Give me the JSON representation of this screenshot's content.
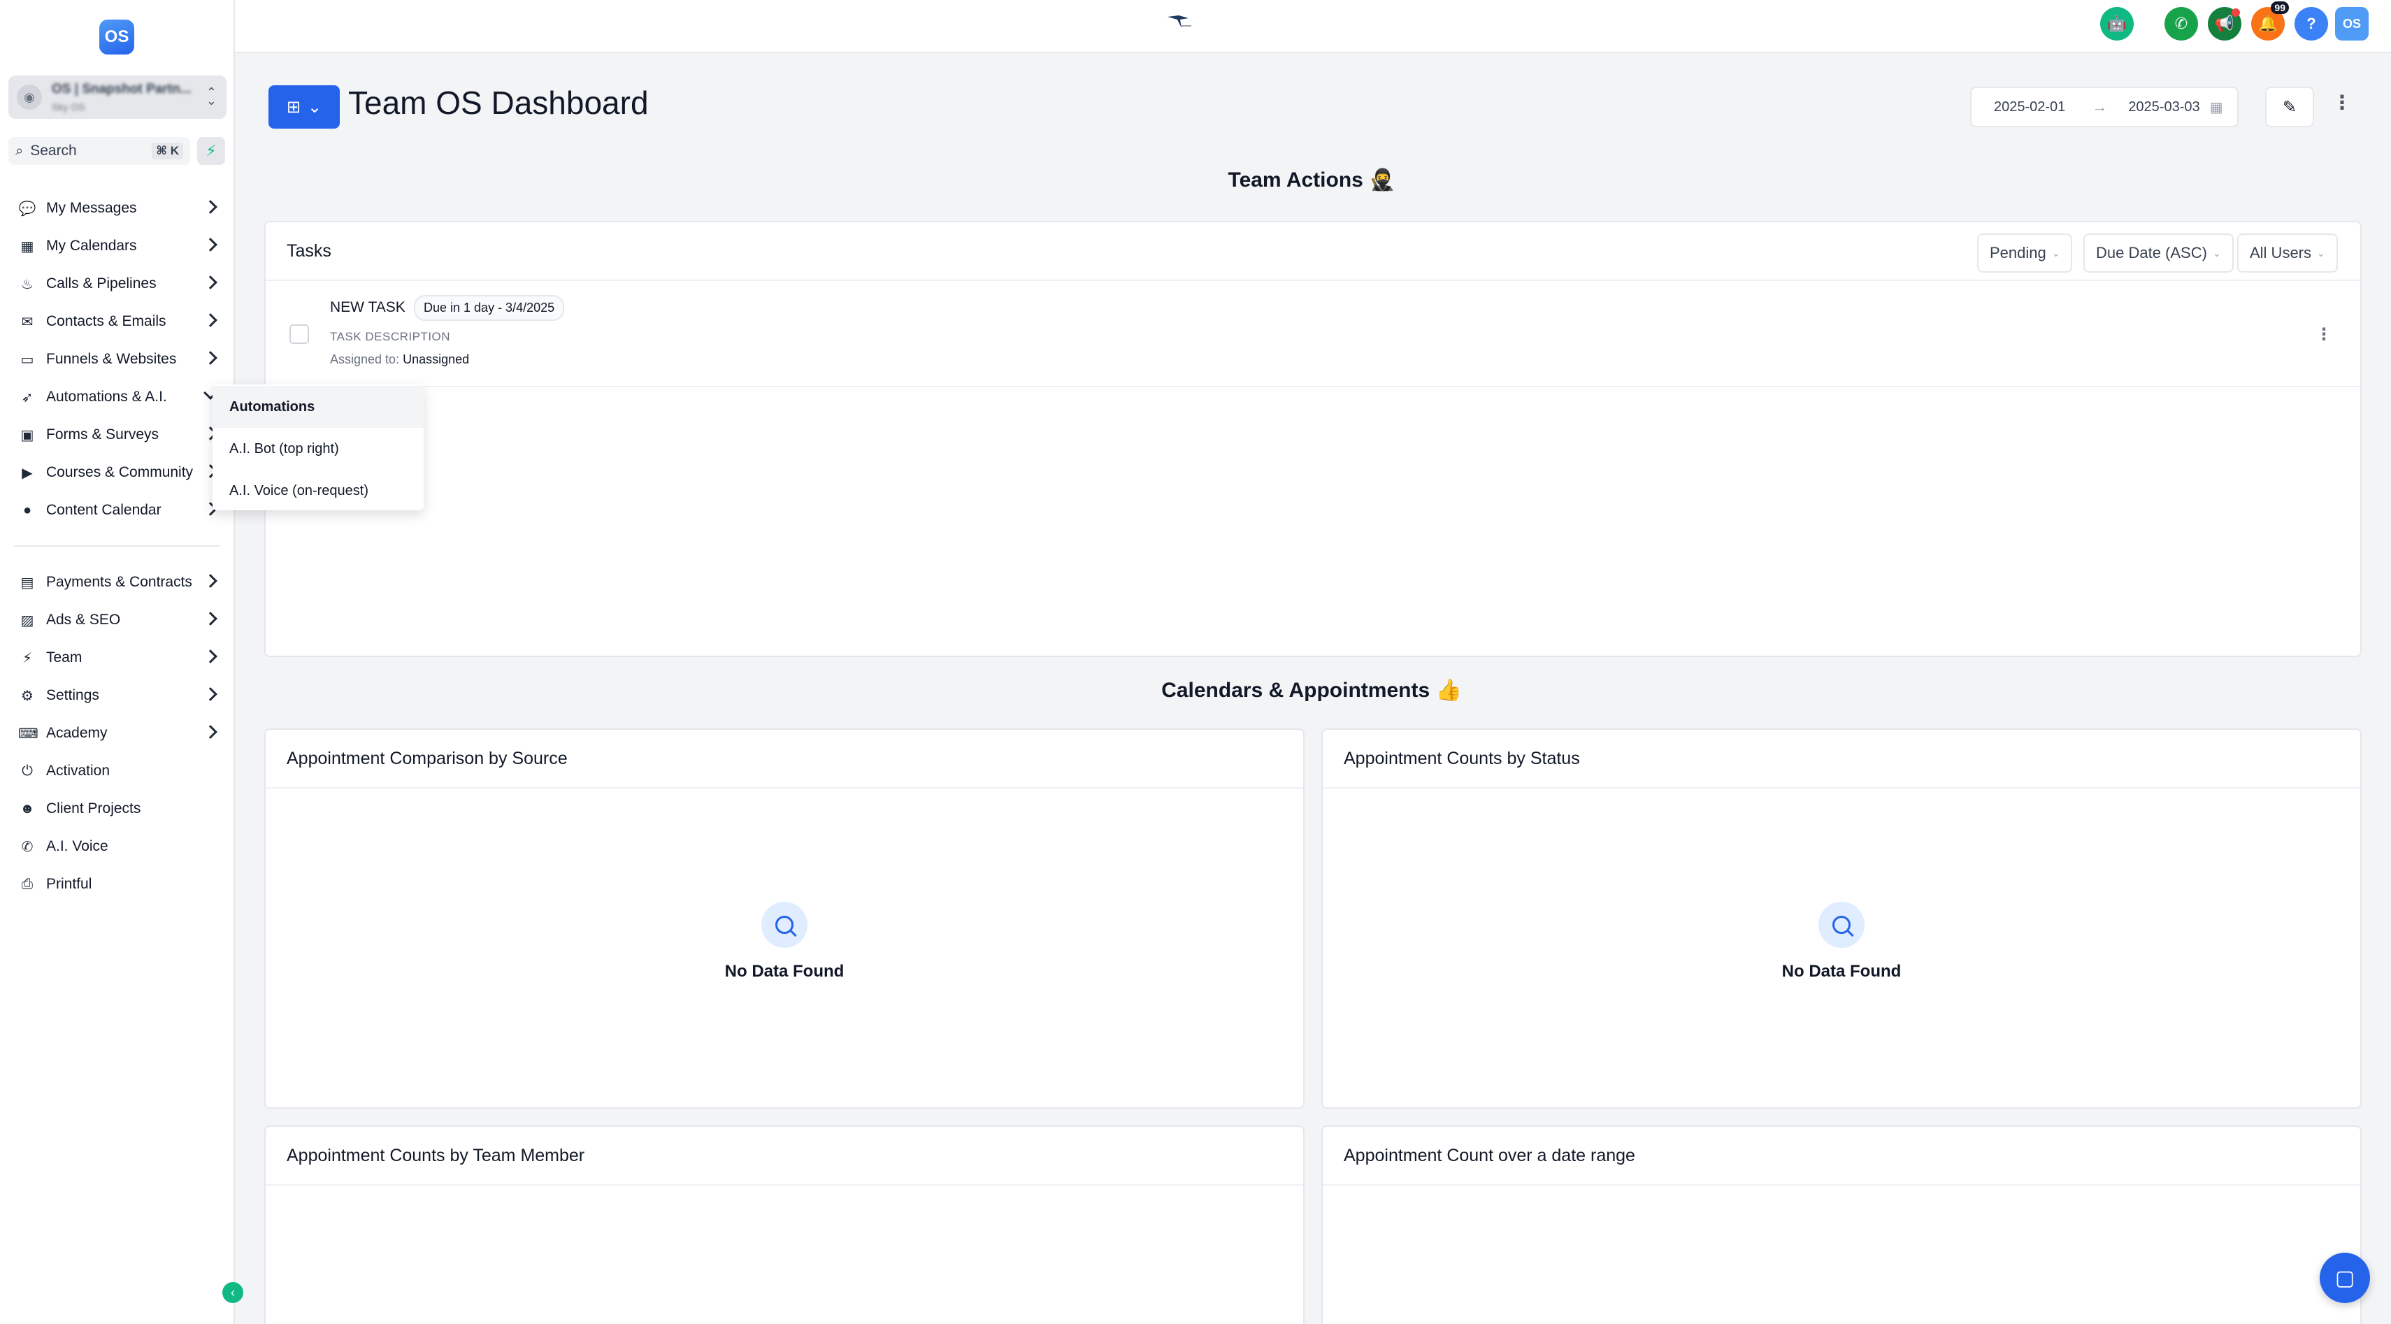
{
  "sidebar": {
    "logo_text": "OS",
    "account": {
      "name": "OS | Snapshot Partn...",
      "sub": "Sky OS"
    },
    "search": {
      "placeholder": "Search",
      "shortcut": "⌘ K"
    },
    "items": [
      {
        "label": "My Messages",
        "icon": "messages-icon",
        "glyph": "💬"
      },
      {
        "label": "My Calendars",
        "icon": "calendar-icon",
        "glyph": "▦"
      },
      {
        "label": "Calls & Pipelines",
        "icon": "flame-icon",
        "glyph": "♨"
      },
      {
        "label": "Contacts & Emails",
        "icon": "mail-icon",
        "glyph": "✉"
      },
      {
        "label": "Funnels & Websites",
        "icon": "monitor-icon",
        "glyph": "▭"
      },
      {
        "label": "Automations & A.I.",
        "icon": "rocket-icon",
        "glyph": "➶"
      },
      {
        "label": "Forms & Surveys",
        "icon": "form-icon",
        "glyph": "▣"
      },
      {
        "label": "Courses & Community",
        "icon": "video-icon",
        "glyph": "▶"
      },
      {
        "label": "Content Calendar",
        "icon": "apple-icon",
        "glyph": "●"
      },
      {
        "label": "Payments & Contracts",
        "icon": "document-icon",
        "glyph": "▤"
      },
      {
        "label": "Ads & SEO",
        "icon": "image-icon",
        "glyph": "▨"
      },
      {
        "label": "Team",
        "icon": "bolt-icon",
        "glyph": "⚡"
      },
      {
        "label": "Settings",
        "icon": "gear-icon",
        "glyph": "⚙"
      },
      {
        "label": "Academy",
        "icon": "keyboard-icon",
        "glyph": "⌨"
      },
      {
        "label": "Activation",
        "icon": "power-icon",
        "glyph": "⏻"
      },
      {
        "label": "Client Projects",
        "icon": "user-icon",
        "glyph": "☻"
      },
      {
        "label": "A.I. Voice",
        "icon": "phone-icon",
        "glyph": "✆"
      },
      {
        "label": "Printful",
        "icon": "printer-icon",
        "glyph": "⎙"
      }
    ],
    "flyout": [
      "Automations",
      "A.I. Bot (top right)",
      "A.I. Voice (on-request)"
    ]
  },
  "topbar": {
    "notification_count": "99",
    "help_label": "?",
    "user_initials": "OS"
  },
  "main": {
    "title": "Team OS Dashboard",
    "date_start": "2025-02-01",
    "date_end": "2025-03-03",
    "team_actions_title": "Team Actions 🥷",
    "tasks": {
      "title": "Tasks",
      "filters": [
        "Pending",
        "Due Date (ASC)",
        "All Users"
      ],
      "items": [
        {
          "name": "NEW TASK",
          "due": "Due in 1 day - 3/4/2025",
          "description": "TASK DESCRIPTION",
          "assigned_label": "Assigned to:",
          "assigned_value": "Unassigned"
        }
      ]
    },
    "calendars_title": "Calendars & Appointments 👍",
    "cards": [
      {
        "title": "Appointment Comparison by Source",
        "empty": "No Data Found"
      },
      {
        "title": "Appointment Counts by Status",
        "empty": "No Data Found"
      },
      {
        "title": "Appointment Counts by Team Member"
      },
      {
        "title": "Appointment Count over a date range"
      }
    ]
  },
  "colors": {
    "accent": "#2563eb",
    "green": "#10b981",
    "call_green": "#16a34a",
    "bell_orange": "#f97316",
    "help_blue": "#3b82f6"
  }
}
